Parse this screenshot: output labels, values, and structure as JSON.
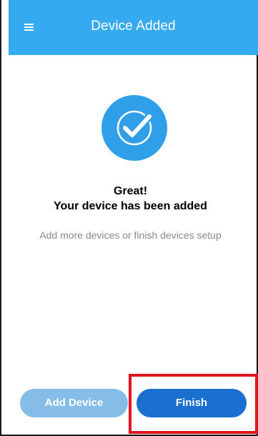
{
  "header": {
    "title": "Device Added",
    "menu_icon": "hamburger-menu-icon"
  },
  "status": {
    "icon": "checkmark-circle-icon",
    "title": "Great!",
    "subtitle": "Your device has been added",
    "hint": "Add more devices or finish devices setup"
  },
  "actions": {
    "add_device_label": "Add Device",
    "finish_label": "Finish"
  },
  "colors": {
    "header_bg": "#36aaf0",
    "badge_bg": "#2f9fe9",
    "add_button_bg": "#86bde8",
    "finish_button_bg": "#1a6fcf",
    "highlight": "#e0141e"
  }
}
